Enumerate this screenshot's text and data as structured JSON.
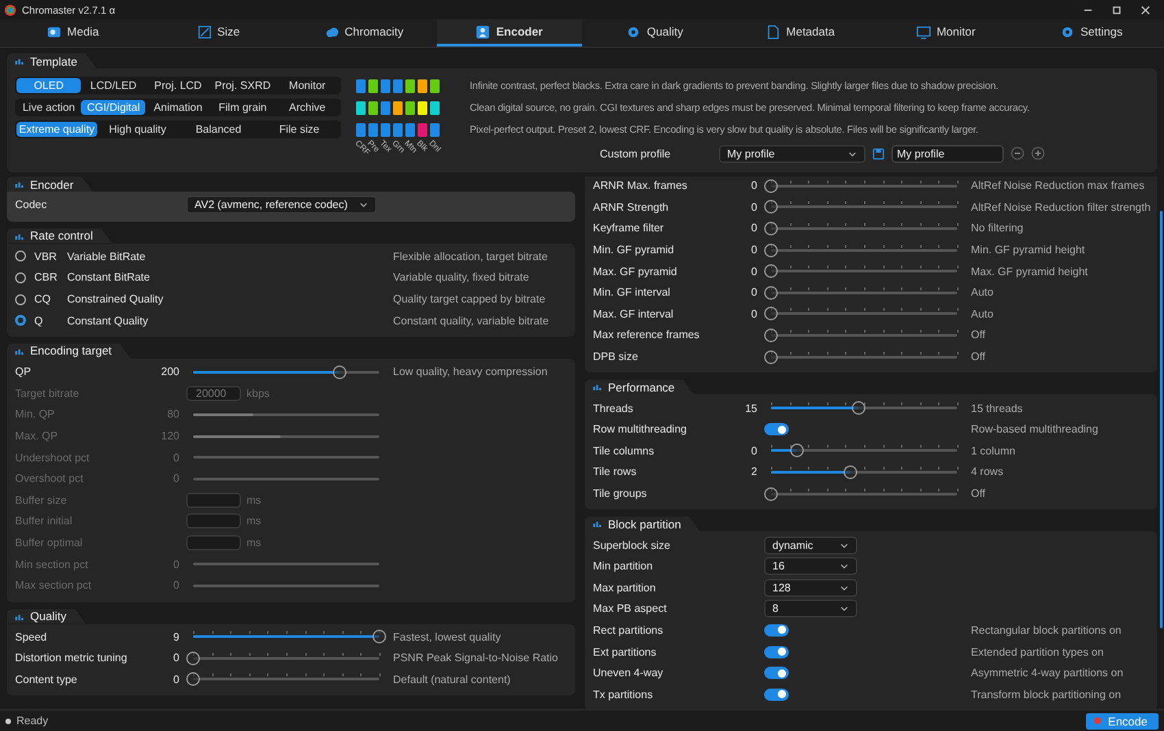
{
  "window": {
    "title": "Chromaster v2.7.1 α"
  },
  "tabs": [
    {
      "label": "Media",
      "selected": false
    },
    {
      "label": "Size",
      "selected": false
    },
    {
      "label": "Chromacity",
      "selected": false
    },
    {
      "label": "Encoder",
      "selected": true
    },
    {
      "label": "Quality",
      "selected": false
    },
    {
      "label": "Metadata",
      "selected": false
    },
    {
      "label": "Monitor",
      "selected": false
    },
    {
      "label": "Settings",
      "selected": false
    }
  ],
  "template": {
    "title": "Template",
    "rows": [
      {
        "options": [
          {
            "label": "OLED",
            "selected": true
          },
          {
            "label": "LCD/LED",
            "selected": false
          },
          {
            "label": "Proj. LCD",
            "selected": false
          },
          {
            "label": "Proj. SXRD",
            "selected": false
          },
          {
            "label": "Monitor",
            "selected": false
          }
        ],
        "swatches": [
          {
            "color": "#1e88e5"
          },
          {
            "color": "#66cc11"
          },
          {
            "color": "#1e88e5"
          },
          {
            "color": "#1e88e5"
          },
          {
            "color": "#66cc11"
          },
          {
            "color": "#f5a300"
          },
          {
            "color": "#66cc11"
          }
        ],
        "description": "Infinite contrast, perfect blacks. Extra care in dark gradients to prevent banding. Slightly larger files due to shadow precision."
      },
      {
        "options": [
          {
            "label": "Live action",
            "selected": false
          },
          {
            "label": "CGI/Digital",
            "selected": true
          },
          {
            "label": "Animation",
            "selected": false
          },
          {
            "label": "Film grain",
            "selected": false
          },
          {
            "label": "Archive",
            "selected": false
          }
        ],
        "swatches": [
          {
            "color": "#11d0d0"
          },
          {
            "color": "#66cc11"
          },
          {
            "color": "#1e88e5"
          },
          {
            "color": "#f5a300"
          },
          {
            "color": "#66cc11"
          },
          {
            "color": "#f0f000"
          },
          {
            "color": "#11d0d0"
          }
        ],
        "description": "Clean digital source, no grain. CGI textures and sharp edges must be preserved. Minimal temporal filtering to keep frame accuracy."
      },
      {
        "options": [
          {
            "label": "Extreme quality",
            "selected": true
          },
          {
            "label": "High quality",
            "selected": false
          },
          {
            "label": "Balanced",
            "selected": false
          },
          {
            "label": "File size",
            "selected": false
          }
        ],
        "swatches": [
          {
            "color": "#1e88e5"
          },
          {
            "color": "#1e88e5"
          },
          {
            "color": "#1e88e5"
          },
          {
            "color": "#1e88e5"
          },
          {
            "color": "#1e88e5"
          },
          {
            "color": "#e0196e"
          },
          {
            "color": "#1e88e5"
          }
        ],
        "description": "Pixel-perfect output. Preset 2, lowest CRF. Encoding is very slow but quality is absolute. Files will be significantly larger."
      }
    ],
    "swatch_labels": [
      "CRF",
      "Pre",
      "Tex",
      "Grn",
      "Mtn",
      "Blk",
      "Dnl"
    ],
    "custom_profile": {
      "label": "Custom profile",
      "selected": "My profile",
      "name": "My profile"
    }
  },
  "left_sections": [
    {
      "title": "Encoder",
      "highlight": true,
      "rows": [
        {
          "kind": "select",
          "label": "Codec",
          "value": "AV2 (avmenc, reference codec)"
        }
      ]
    },
    {
      "title": "Rate control",
      "highlight": false,
      "rows": [
        {
          "kind": "radio",
          "code": "VBR",
          "label": "Variable BitRate",
          "note": "Flexible allocation, target bitrate",
          "selected": false
        },
        {
          "kind": "radio",
          "code": "CBR",
          "label": "Constant BitRate",
          "note": "Variable quality, fixed bitrate",
          "selected": false
        },
        {
          "kind": "radio",
          "code": "CQ",
          "label": "Constrained Quality",
          "note": "Quality target capped by bitrate",
          "selected": false
        },
        {
          "kind": "radio",
          "code": "Q",
          "label": "Constant Quality",
          "note": "Constant quality, variable bitrate",
          "selected": true
        }
      ]
    },
    {
      "title": "Encoding target",
      "highlight": false,
      "rows": [
        {
          "kind": "slider",
          "label": "QP",
          "value": "200",
          "level": 0.79,
          "ticks": false,
          "disabled": false,
          "note": "Low quality, heavy compression"
        },
        {
          "kind": "field",
          "label": "Target bitrate",
          "value": "20000",
          "unit": "kbps",
          "disabled": true
        },
        {
          "kind": "slider",
          "label": "Min. QP",
          "value": "80",
          "level": 0.32,
          "ticks": false,
          "disabled": true
        },
        {
          "kind": "slider",
          "label": "Max. QP",
          "value": "120",
          "level": 0.47,
          "ticks": false,
          "disabled": true
        },
        {
          "kind": "slider",
          "label": "Undershoot pct",
          "value": "0",
          "level": 0,
          "ticks": false,
          "disabled": true
        },
        {
          "kind": "slider",
          "label": "Overshoot pct",
          "value": "0",
          "level": 0,
          "ticks": false,
          "disabled": true
        },
        {
          "kind": "field",
          "label": "Buffer size",
          "unit": "ms",
          "disabled": true
        },
        {
          "kind": "field",
          "label": "Buffer initial",
          "unit": "ms",
          "disabled": true
        },
        {
          "kind": "field",
          "label": "Buffer optimal",
          "unit": "ms",
          "disabled": true
        },
        {
          "kind": "slider",
          "label": "Min section pct",
          "value": "0",
          "level": 0,
          "ticks": false,
          "disabled": true
        },
        {
          "kind": "slider",
          "label": "Max section pct",
          "value": "0",
          "level": 0,
          "ticks": false,
          "disabled": true
        }
      ]
    },
    {
      "title": "Quality",
      "highlight": false,
      "rows": [
        {
          "kind": "slider",
          "label": "Speed",
          "value": "9",
          "level": 1,
          "ticks": true,
          "note": "Fastest, lowest quality"
        },
        {
          "kind": "slider",
          "label": "Distortion metric tuning",
          "value": "0",
          "level": 0,
          "ticks": true,
          "note": "PSNR Peak Signal-to-Noise Ratio"
        },
        {
          "kind": "slider",
          "label": "Content type",
          "value": "0",
          "level": 0,
          "ticks": true,
          "note": "Default (natural content)"
        }
      ]
    }
  ],
  "right_sections": [
    {
      "highlight": false,
      "rows": [
        {
          "kind": "slider",
          "label": "ARNR Max. frames",
          "value": "0",
          "level": 0,
          "ticks": true,
          "note": "AltRef Noise Reduction max frames"
        },
        {
          "kind": "slider",
          "label": "ARNR Strength",
          "value": "0",
          "level": 0,
          "ticks": true,
          "note": "AltRef Noise Reduction filter strength"
        },
        {
          "kind": "slider",
          "label": "Keyframe filter",
          "value": "0",
          "level": 0,
          "ticks": true,
          "note": "No filtering"
        },
        {
          "kind": "slider",
          "label": "Min. GF pyramid",
          "value": "0",
          "level": 0,
          "ticks": true,
          "note": "Min. GF pyramid height"
        },
        {
          "kind": "slider",
          "label": "Max. GF pyramid",
          "value": "0",
          "level": 0,
          "ticks": true,
          "note": "Max. GF pyramid height"
        },
        {
          "kind": "slider",
          "label": "Min. GF interval",
          "value": "0",
          "level": 0,
          "ticks": true,
          "note": "Auto"
        },
        {
          "kind": "slider",
          "label": "Max. GF interval",
          "value": "0",
          "level": 0,
          "ticks": true,
          "note": "Auto"
        },
        {
          "kind": "slider",
          "label": "Max reference frames",
          "level": 0,
          "ticks": true,
          "note": "Off"
        },
        {
          "kind": "slider",
          "label": "DPB size",
          "level": 0,
          "ticks": true,
          "note": "Off"
        }
      ]
    },
    {
      "title": "Performance",
      "highlight": false,
      "rows": [
        {
          "kind": "slider",
          "label": "Threads",
          "value": "15",
          "level": 0.47,
          "ticks": true,
          "note": "15 threads"
        },
        {
          "kind": "toggle",
          "label": "Row multithreading",
          "on": true,
          "note": "Row-based multithreading"
        },
        {
          "kind": "slider",
          "label": "Tile columns",
          "value": "0",
          "level": 0.14,
          "ticks": true,
          "note": "1 column"
        },
        {
          "kind": "slider",
          "label": "Tile rows",
          "value": "2",
          "level": 0.43,
          "ticks": true,
          "note": "4 rows"
        },
        {
          "kind": "slider",
          "label": "Tile groups",
          "level": 0,
          "ticks": true,
          "note": "Off"
        }
      ]
    },
    {
      "title": "Block partition",
      "highlight": false,
      "rows": [
        {
          "kind": "select",
          "label": "Superblock size",
          "value": "dynamic"
        },
        {
          "kind": "select",
          "label": "Min partition",
          "value": "16"
        },
        {
          "kind": "select",
          "label": "Max partition",
          "value": "128"
        },
        {
          "kind": "select",
          "label": "Max PB aspect",
          "value": "8"
        },
        {
          "kind": "toggle",
          "label": "Rect partitions",
          "on": true,
          "note": "Rectangular block partitions on"
        },
        {
          "kind": "toggle",
          "label": "Ext partitions",
          "on": true,
          "note": "Extended partition types on"
        },
        {
          "kind": "toggle",
          "label": "Uneven 4-way",
          "on": true,
          "note": "Asymmetric 4-way partitions on"
        },
        {
          "kind": "toggle",
          "label": "Tx partitions",
          "on": true,
          "note": "Transform block partitioning on"
        }
      ]
    }
  ],
  "status_bar": {
    "text": "Ready",
    "button": "Encode"
  }
}
